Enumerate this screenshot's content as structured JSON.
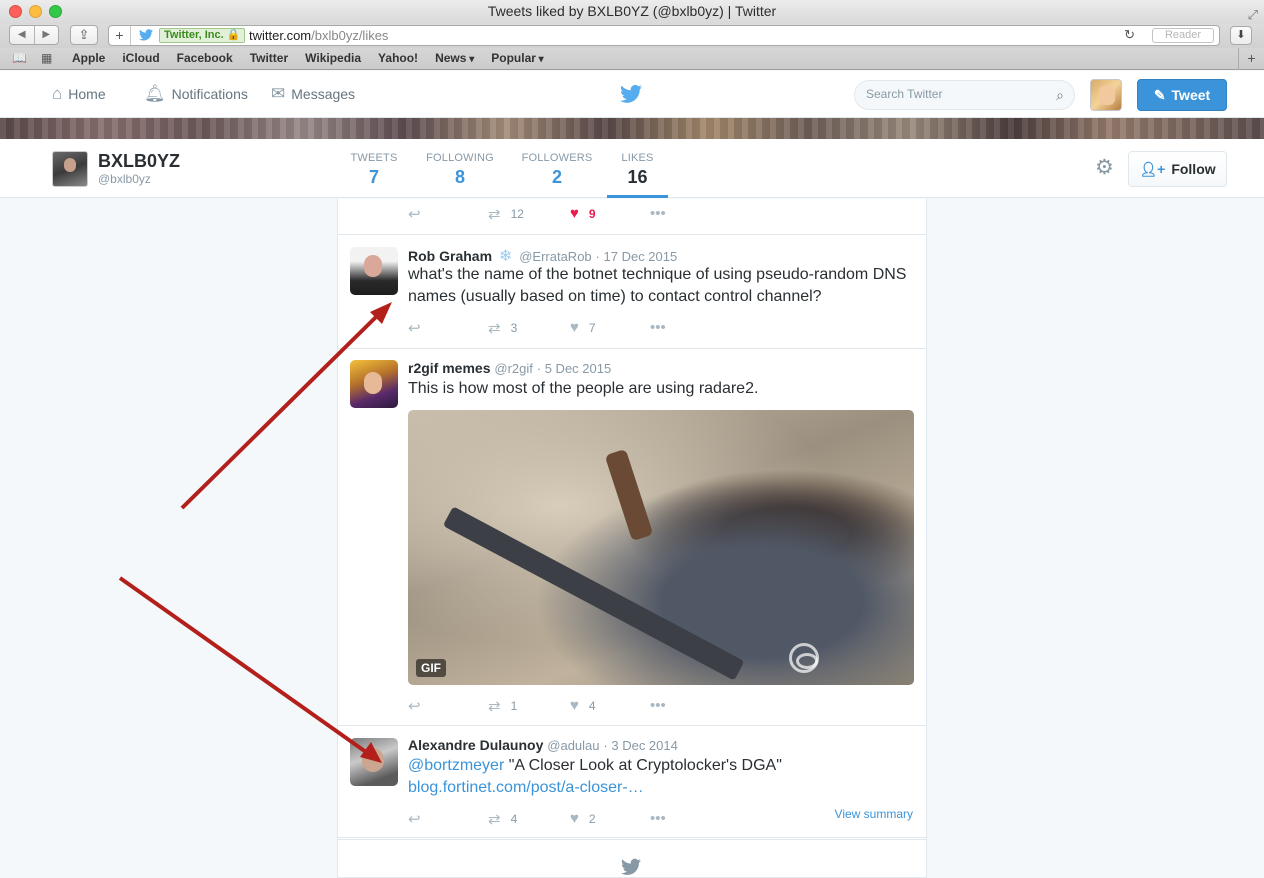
{
  "window": {
    "title": "Tweets liked by BXLB0YZ (@bxlb0yz) | Twitter"
  },
  "browser": {
    "ev_label": "Twitter, Inc.",
    "url_host": "twitter.com",
    "url_path": "/bxlb0yz/likes",
    "reader_label": "Reader",
    "bookmarks": [
      "Apple",
      "iCloud",
      "Facebook",
      "Twitter",
      "Wikipedia",
      "Yahoo!"
    ],
    "bookmark_menus": [
      "News",
      "Popular"
    ]
  },
  "nav": {
    "home": "Home",
    "notifications": "Notifications",
    "messages": "Messages",
    "search_placeholder": "Search Twitter",
    "tweet_button": "Tweet"
  },
  "profile": {
    "name": "BXLB0YZ",
    "handle": "@bxlb0yz",
    "stats": [
      {
        "label": "TWEETS",
        "value": "7"
      },
      {
        "label": "FOLLOWING",
        "value": "8"
      },
      {
        "label": "FOLLOWERS",
        "value": "2"
      },
      {
        "label": "LIKES",
        "value": "16"
      }
    ],
    "active_tab": "LIKES",
    "follow_label": "Follow"
  },
  "timeline": {
    "prev_tweet_actions": {
      "retweets": "12",
      "likes": "9"
    },
    "tweets": [
      {
        "name": "Rob Graham",
        "handle": "@ErrataRob",
        "date": "17 Dec 2015",
        "text": "what's the name of the botnet technique of using pseudo-random DNS names (usually based on time) to contact control channel?",
        "retweets": "3",
        "likes": "7"
      },
      {
        "name": "r2gif memes",
        "handle": "@r2gif",
        "date": "5 Dec 2015",
        "text": "This is how most of the people are using radare2.",
        "media_badge": "GIF",
        "retweets": "1",
        "likes": "4"
      },
      {
        "name": "Alexandre Dulaunoy",
        "handle": "@adulau",
        "date": "3 Dec 2014",
        "mention": "@bortzmeyer",
        "text": " \"A Closer Look at Cryptolocker's DGA\"",
        "link": "blog.fortinet.com/post/a-closer-…",
        "view_summary": "View summary",
        "retweets": "4",
        "likes": "2"
      }
    ]
  },
  "colors": {
    "twitter_blue": "#3b94d9",
    "like_red": "#e81c4f",
    "annotation_arrow": "#b3201c"
  }
}
